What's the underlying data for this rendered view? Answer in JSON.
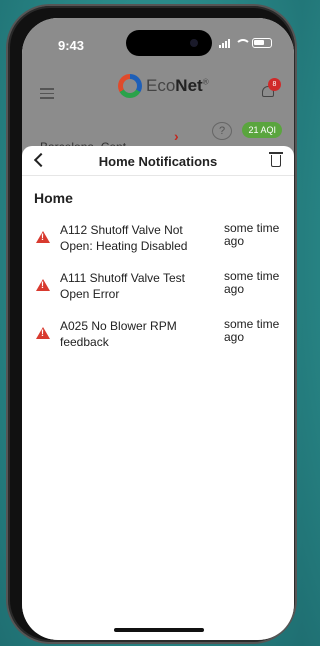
{
  "status_bar": {
    "time": "9:43"
  },
  "app_header": {
    "logo_text": "Eco",
    "logo_bold": "Net",
    "logo_reg": "®",
    "notification_count": "8"
  },
  "subheader": {
    "location": "Barcelona, Cent...",
    "help": "?",
    "aqi": "21 AQI"
  },
  "sheet": {
    "title": "Home Notifications",
    "section": "Home",
    "notifications": [
      {
        "message": "A112 Shutoff Valve Not Open: Heating Disabled",
        "time": "some time ago"
      },
      {
        "message": "A111 Shutoff Valve Test Open Error",
        "time": "some time ago"
      },
      {
        "message": "A025 No Blower RPM feedback",
        "time": "some time ago"
      }
    ]
  },
  "colors": {
    "accent": "#d83a2f",
    "aqi_green": "#5aa53e",
    "logo_blue": "#1d5fb8",
    "logo_green": "#2aa24a",
    "logo_red": "#e04a2b"
  },
  "icons": [
    "menu-icon",
    "bell-icon",
    "back-chevron-icon",
    "trash-icon",
    "warning-icon"
  ]
}
